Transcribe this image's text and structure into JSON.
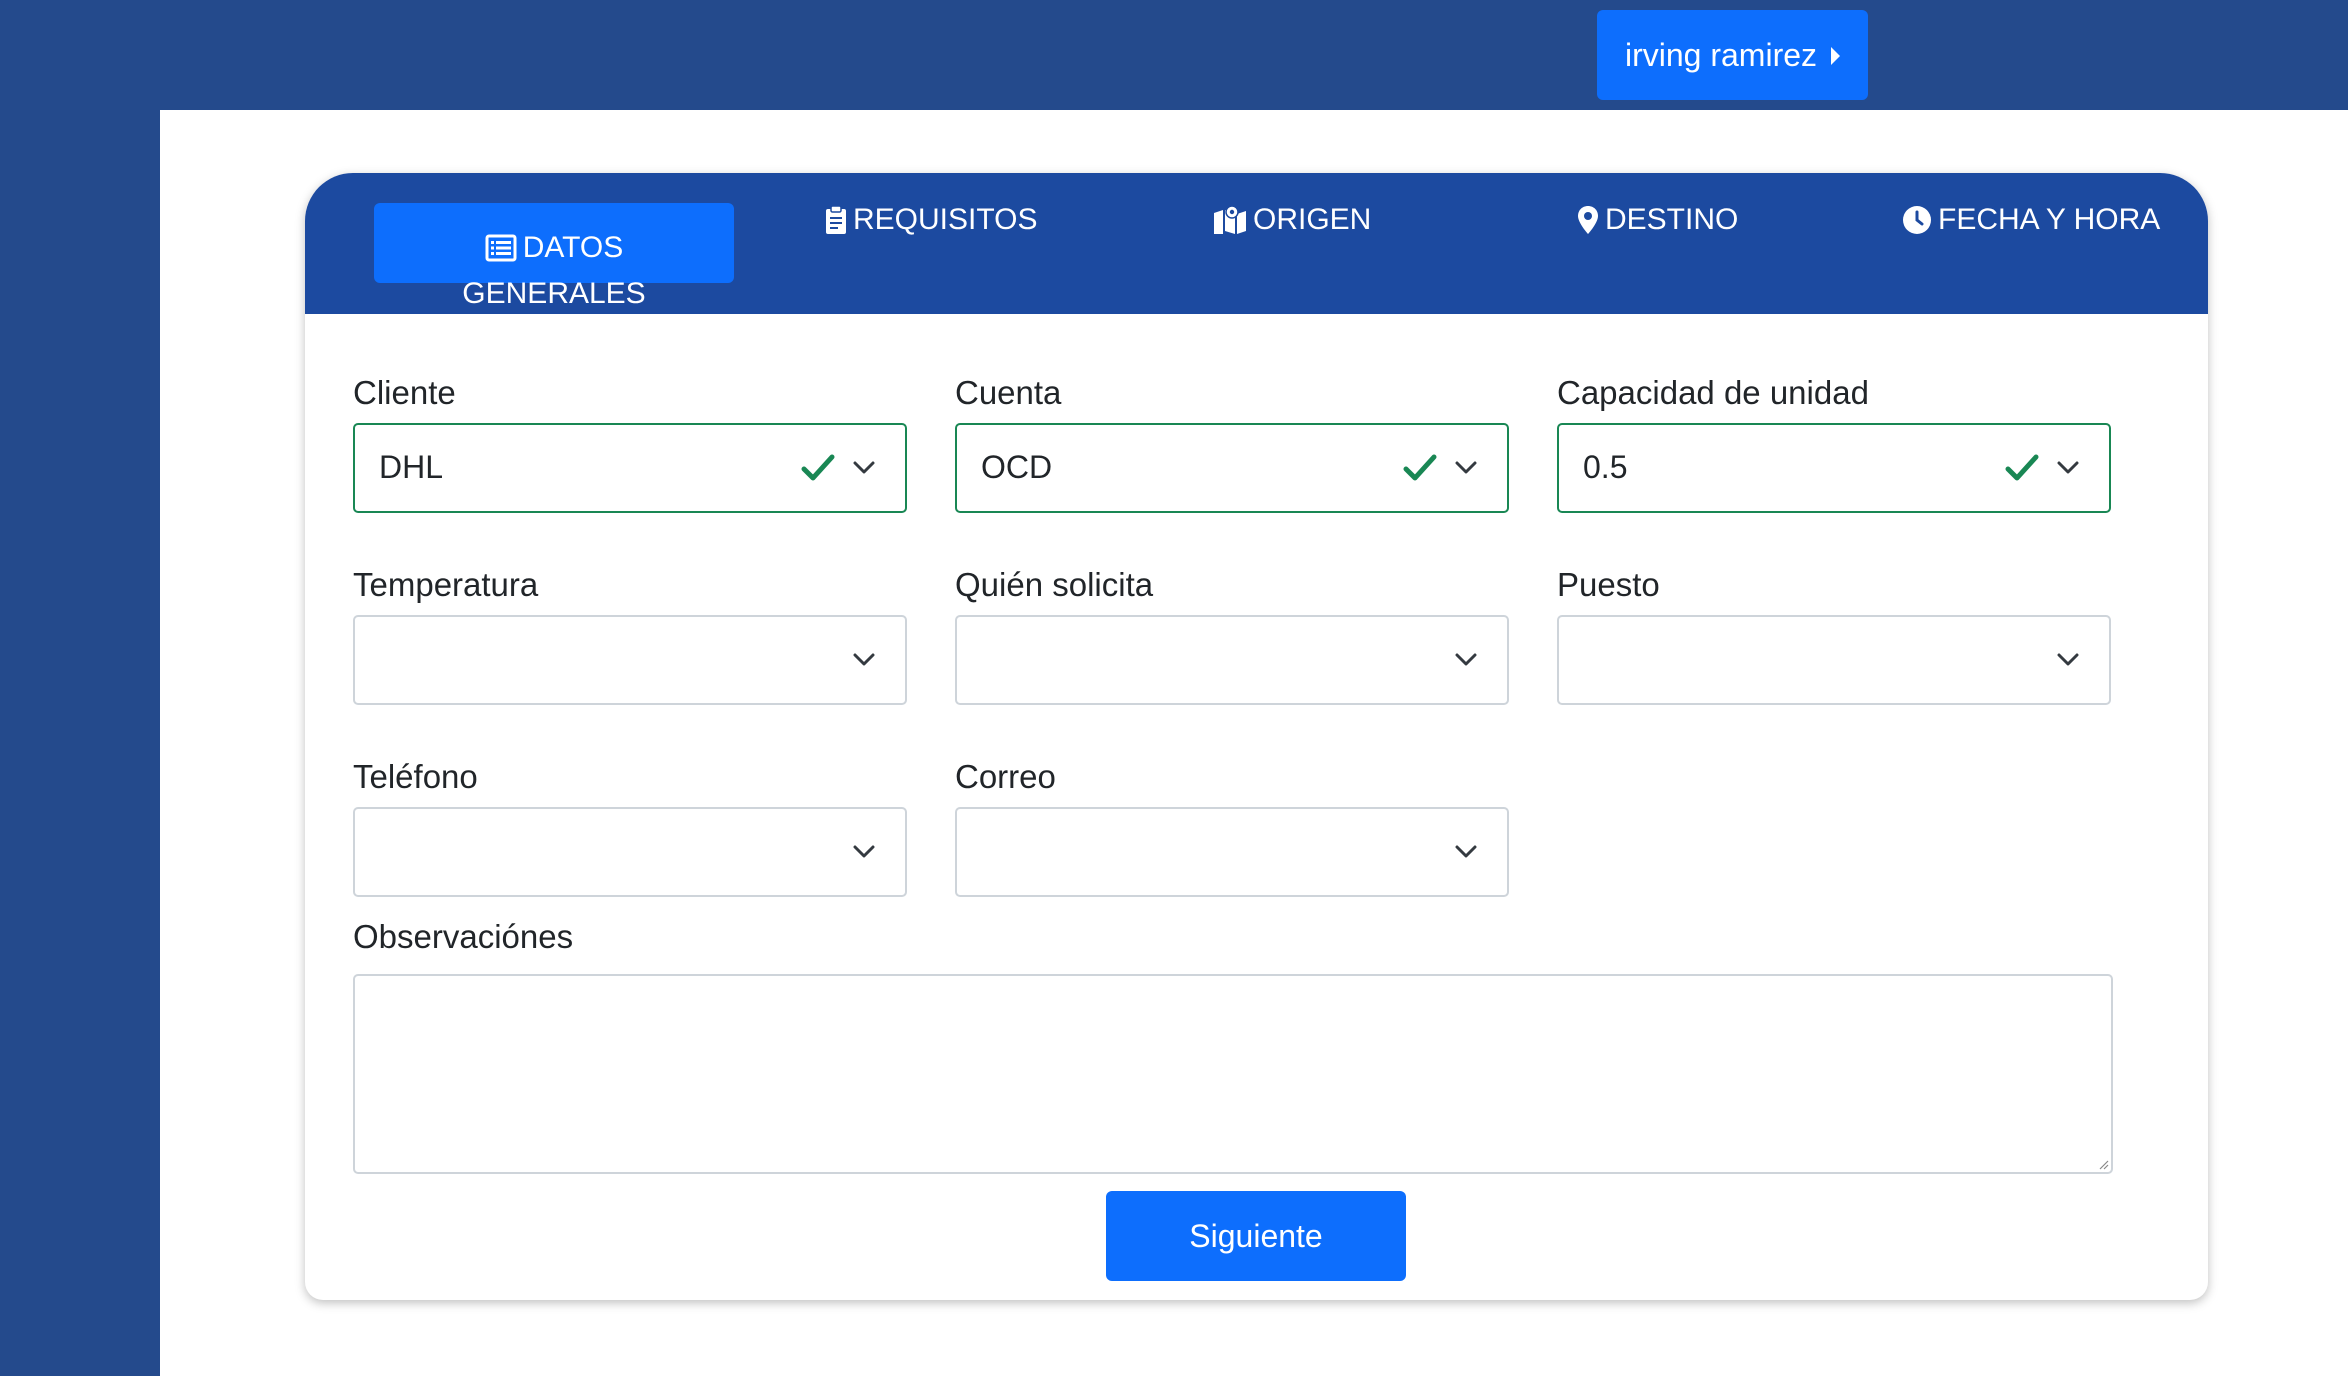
{
  "header": {
    "user_name": "irving ramirez"
  },
  "tabs": {
    "datos_generales": {
      "label_line1": "DATOS",
      "label_line2": "GENERALES",
      "icon": "list-icon"
    },
    "requisitos": {
      "label": "REQUISITOS",
      "icon": "clipboard-icon"
    },
    "origen": {
      "label": "ORIGEN",
      "icon": "map-icon"
    },
    "destino": {
      "label": "DESTINO",
      "icon": "map-marker-icon"
    },
    "fecha_hora": {
      "label": "FECHA Y HORA",
      "icon": "clock-icon"
    }
  },
  "form": {
    "cliente": {
      "label": "Cliente",
      "value": "DHL"
    },
    "cuenta": {
      "label": "Cuenta",
      "value": "OCD"
    },
    "capacidad": {
      "label": "Capacidad de unidad",
      "value": "0.5"
    },
    "temperatura": {
      "label": "Temperatura",
      "value": ""
    },
    "quien_solicita": {
      "label": "Quién solicita",
      "value": ""
    },
    "puesto": {
      "label": "Puesto",
      "value": ""
    },
    "telefono": {
      "label": "Teléfono",
      "value": ""
    },
    "correo": {
      "label": "Correo",
      "value": ""
    },
    "observaciones": {
      "label": "Observaciónes",
      "value": ""
    },
    "next_button": "Siguiente"
  },
  "colors": {
    "primary": "#0d6efd",
    "nav": "#244a8c",
    "header": "#1c4aa0",
    "valid": "#198754"
  }
}
